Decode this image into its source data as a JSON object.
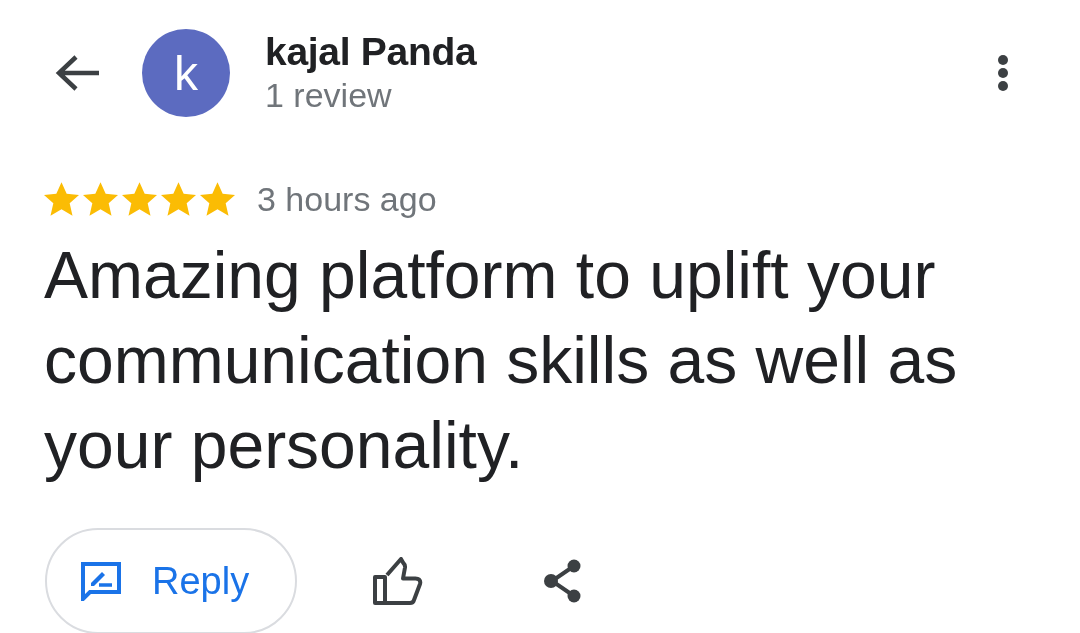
{
  "header": {
    "avatar": {
      "letter": "k"
    },
    "name": "kajal Panda",
    "review_count": "1 review"
  },
  "review": {
    "stars": 5,
    "time": "3 hours ago",
    "text": "Amazing platform to uplift your communication skills as well as your personality."
  },
  "actions": {
    "reply": "Reply"
  }
}
